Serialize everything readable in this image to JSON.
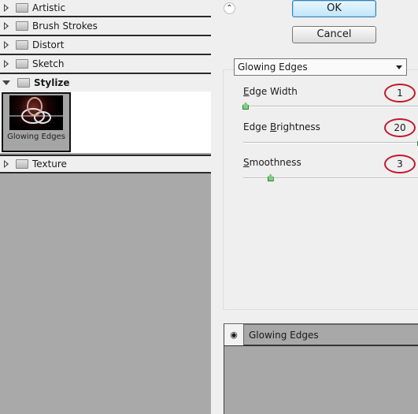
{
  "categories": [
    {
      "label": "Artistic",
      "expanded": false
    },
    {
      "label": "Brush Strokes",
      "expanded": false
    },
    {
      "label": "Distort",
      "expanded": false
    },
    {
      "label": "Sketch",
      "expanded": false
    },
    {
      "label": "Stylize",
      "expanded": true
    },
    {
      "label": "Texture",
      "expanded": false
    }
  ],
  "stylize_filters": [
    {
      "label": "Glowing Edges",
      "selected": true
    }
  ],
  "buttons": {
    "ok": "OK",
    "cancel": "Cancel",
    "collapse_icon": "double-chevron-up-icon"
  },
  "filter_select": {
    "value": "Glowing Edges"
  },
  "params": [
    {
      "label_u": "E",
      "label_rest": "dge Width",
      "label_pre": "",
      "value": "1",
      "min": 1,
      "max": 14
    },
    {
      "label_pre": "Edge ",
      "label_u": "B",
      "label_rest": "rightness",
      "value": "20",
      "min": 0,
      "max": 20
    },
    {
      "label_pre": "",
      "label_u": "S",
      "label_rest": "moothness",
      "value": "3",
      "min": 1,
      "max": 15
    }
  ],
  "highlight_color": "#c0182a",
  "effect_layers": [
    {
      "label": "Glowing Edges",
      "visible": true
    }
  ]
}
